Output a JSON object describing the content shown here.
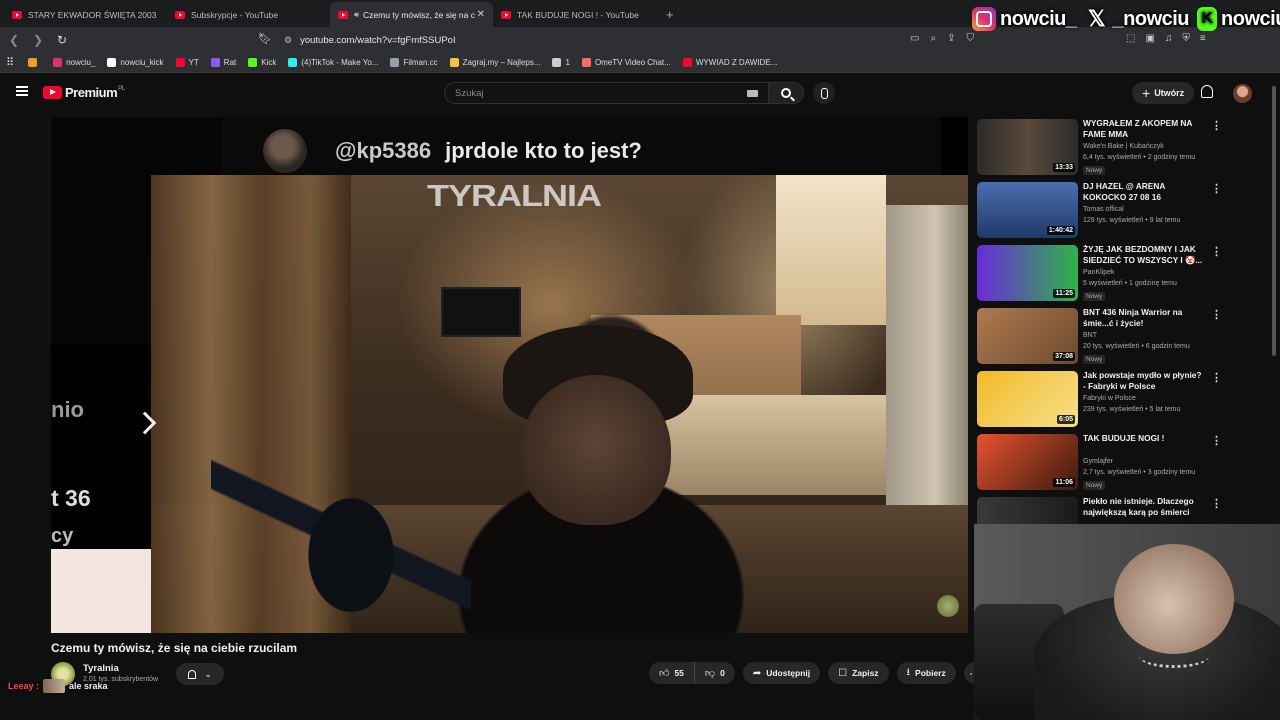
{
  "browser": {
    "tabs": [
      {
        "title": "STARY EKWADOR ŚWIĘTA 2003",
        "active": false
      },
      {
        "title": "Subskrypcje - YouTube",
        "active": false
      },
      {
        "title": "Czemu ty mówisz, że się na c",
        "active": true
      },
      {
        "title": "TAK BUDUJE NOGI ! - YouTube",
        "active": false
      }
    ],
    "url": "youtube.com/watch?v=fgFmfSSUPoI",
    "bookmarks": [
      {
        "label": "nowciu_",
        "color": "#e1306c"
      },
      {
        "label": "nowciu_kick",
        "color": "#ffffff"
      },
      {
        "label": "YT",
        "color": "#ff0033"
      },
      {
        "label": "Rat",
        "color": "#8a5cf6"
      },
      {
        "label": "Kick",
        "color": "#53fc18"
      },
      {
        "label": "(4)TikTok - Make Yo...",
        "color": "#25f4ee"
      },
      {
        "label": "Filman.cc",
        "color": "#9aa0a6"
      },
      {
        "label": "Zagraj.my – Najleps...",
        "color": "#f4c542"
      },
      {
        "label": "1",
        "color": "#cccccc"
      },
      {
        "label": "OmeTV Video Chat...",
        "color": "#ff6b6b"
      },
      {
        "label": "WYWIAD Z DAWIDE...",
        "color": "#ff0033"
      }
    ]
  },
  "social": {
    "instagram": "nowciu_",
    "x": "_nowciu",
    "kick": "nowciu"
  },
  "youtube": {
    "logo": "Premium",
    "region": "PL",
    "search_placeholder": "Szukaj",
    "create_label": "Utwórz"
  },
  "player": {
    "comment_handle": "@kp5386",
    "comment_text": "jprdole kto to jest?",
    "watermark": "TYRALNIA",
    "left_fragments": [
      "nio",
      "t 36",
      "cy Pedofili"
    ]
  },
  "video": {
    "title": "Czemu ty mówisz, że się na ciebie rzucilam",
    "channel": "Tyralnia",
    "subscribers": "2,01 tys. subskrybentów",
    "likes": "55",
    "dislikes": "0",
    "share_label": "Udostępnij",
    "save_label": "Zapisz",
    "download_label": "Pobierz"
  },
  "chat": {
    "user": "Leeay :",
    "message": "ale sraka"
  },
  "recommendations": [
    {
      "title": "WYGRAŁEM Z AKOPEM NA FAME MMA",
      "channel": "Wake'n Bake | Kubańczyk",
      "meta": "6,4 tys. wyświetleń • 2 godziny temu",
      "badge": "Nowy",
      "duration": "13:33",
      "thumb": "linear-gradient(90deg,#2b2b2b,#5b4a3c,#2b2b2b)"
    },
    {
      "title": "DJ HAZEL @ ARENA KOKOCKO 27 08 16",
      "channel": "Tomas offical",
      "meta": "129 tys. wyświetleń • 9 lat temu",
      "badge": "",
      "duration": "1:40:42",
      "thumb": "linear-gradient(180deg,#4a6fb0,#1f3a66)"
    },
    {
      "title": "ŻYJĘ JAK BEZDOMNY I JAK SIEDZIEĆ TO WSZYSCY I 🤡...",
      "channel": "PanKlipek",
      "meta": "5 wyświetleń • 1 godzinę temu",
      "badge": "Nowy",
      "duration": "11:25",
      "thumb": "linear-gradient(90deg,#6a2bd9,#2fb34a)"
    },
    {
      "title": "BNT 436 Ninja Warrior na śmie...ć i życie!",
      "channel": "BNT",
      "meta": "20 tys. wyświetleń • 6 godzin temu",
      "badge": "Nowy",
      "duration": "37:08",
      "thumb": "linear-gradient(135deg,#b07a4f,#6b4a2f)"
    },
    {
      "title": "Jak powstaje mydło w płynie? - Fabryki w Polsce",
      "channel": "Fabryki w Polsce",
      "meta": "239 tys. wyświetleń • 5 lat temu",
      "badge": "",
      "duration": "6:05",
      "thumb": "linear-gradient(135deg,#f3b928,#f5e08a)"
    },
    {
      "title": "TAK BUDUJE NOGI !",
      "channel": "Gymlajfer",
      "meta": "2,7 tys. wyświetleń • 3 godziny temu",
      "badge": "Nowy",
      "duration": "11:06",
      "thumb": "linear-gradient(135deg,#e8532b,#3b1a12)"
    },
    {
      "title": "Piekło nie istnieje. Dlaczego największą karą po śmierci jes...",
      "channel": "",
      "meta": "",
      "badge": "",
      "duration": "",
      "thumb": "linear-gradient(90deg,#3a3a3a,#1a1a1a)"
    }
  ]
}
